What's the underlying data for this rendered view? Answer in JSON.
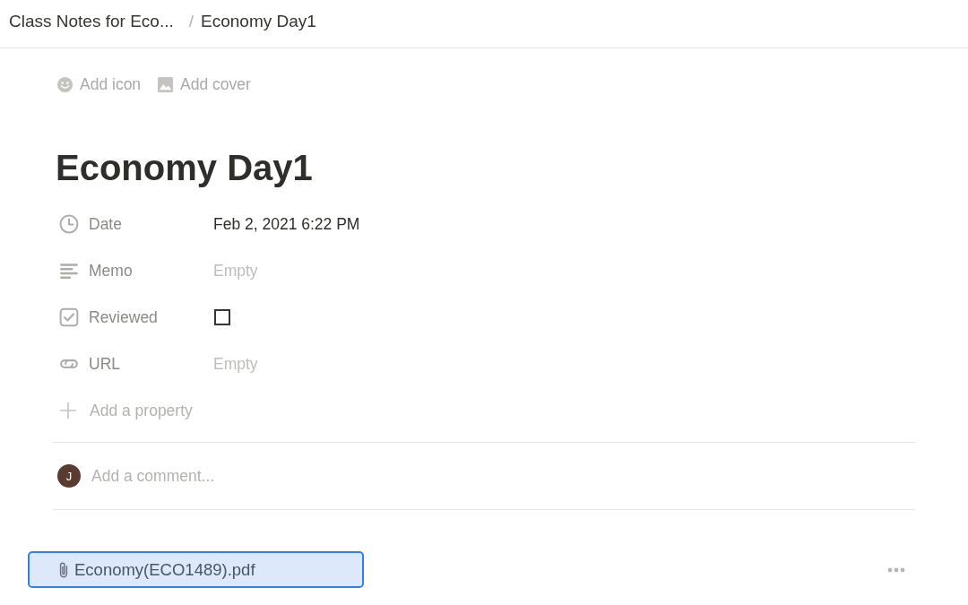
{
  "breadcrumb": {
    "items": [
      {
        "label": "Class Notes for Eco..."
      },
      {
        "label": "Economy Day1"
      }
    ],
    "separator": "/"
  },
  "page_actions": [
    {
      "kind": "icon",
      "label": "Add icon"
    },
    {
      "kind": "cover",
      "label": "Add cover"
    }
  ],
  "title": "Economy Day1",
  "properties": [
    {
      "kind": "date",
      "name": "Date",
      "value": "Feb 2, 2021 6:22 PM"
    },
    {
      "kind": "text",
      "name": "Memo",
      "placeholder": "Empty"
    },
    {
      "kind": "checkbox",
      "name": "Reviewed",
      "checked": false
    },
    {
      "kind": "url",
      "name": "URL",
      "placeholder": "Empty"
    }
  ],
  "add_property": {
    "label": "Add a property"
  },
  "comment": {
    "avatar_initial": "J",
    "placeholder": "Add a comment..."
  },
  "attachment": {
    "filename": "Economy(ECO1489).pdf",
    "selected": true
  }
}
